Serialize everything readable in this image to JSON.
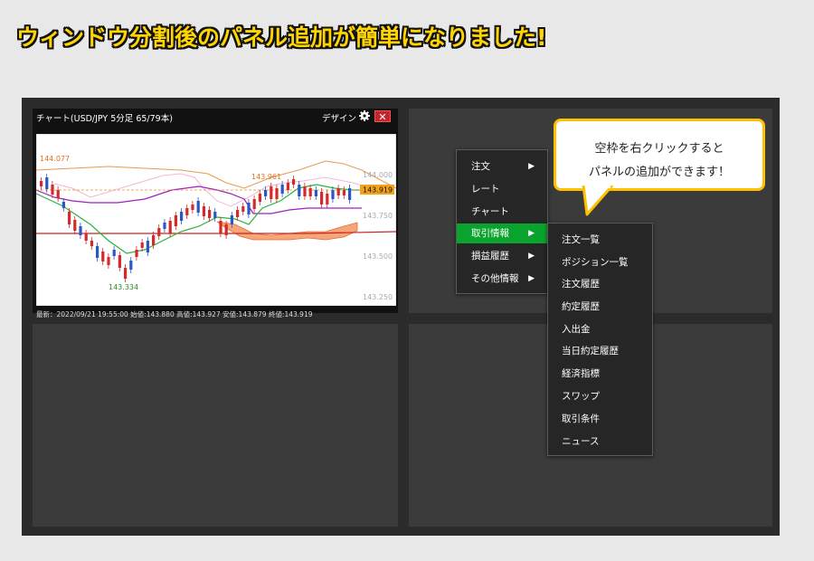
{
  "headline": "ウィンドウ分割後のパネル追加が簡単になりました!",
  "chart_panel": {
    "title": "チャート(USD/JPY 5分足 65/79本)",
    "design_label": "デザイン",
    "close_glyph": "✕",
    "status": "最新：2022/09/21 19:55:00 始値:143.880 高値:143.927 安値:143.879 終値:143.919"
  },
  "chart_data": {
    "type": "candlestick",
    "title": "",
    "price_ticks": [
      "144.000",
      "143.750",
      "143.500",
      "143.250"
    ],
    "ylim": [
      143.2,
      144.3
    ],
    "current_price_label": "143.919",
    "high_annotation": "143.961",
    "session_high_annotation": "144.077",
    "low_annotation": "143.334"
  },
  "context_menu": {
    "items": [
      {
        "label": "注文",
        "arrow": "▶"
      },
      {
        "label": "レート",
        "arrow": ""
      },
      {
        "label": "チャート",
        "arrow": ""
      },
      {
        "label": "取引情報",
        "arrow": "▶",
        "active": true
      },
      {
        "label": "損益履歴",
        "arrow": "▶"
      },
      {
        "label": "その他情報",
        "arrow": "▶"
      }
    ],
    "submenu": [
      "注文一覧",
      "ポジション一覧",
      "注文履歴",
      "約定履歴",
      "入出金",
      "当日約定履歴",
      "経済指標",
      "スワップ",
      "取引条件",
      "ニュース"
    ]
  },
  "balloon": {
    "line1": "空枠を右クリックすると",
    "line2": "パネルの追加ができます！"
  },
  "colors": {
    "headline": "#ffd400",
    "active_menu": "#0aa32d",
    "balloon_border": "#ffc000",
    "close_button": "#c2252c"
  }
}
